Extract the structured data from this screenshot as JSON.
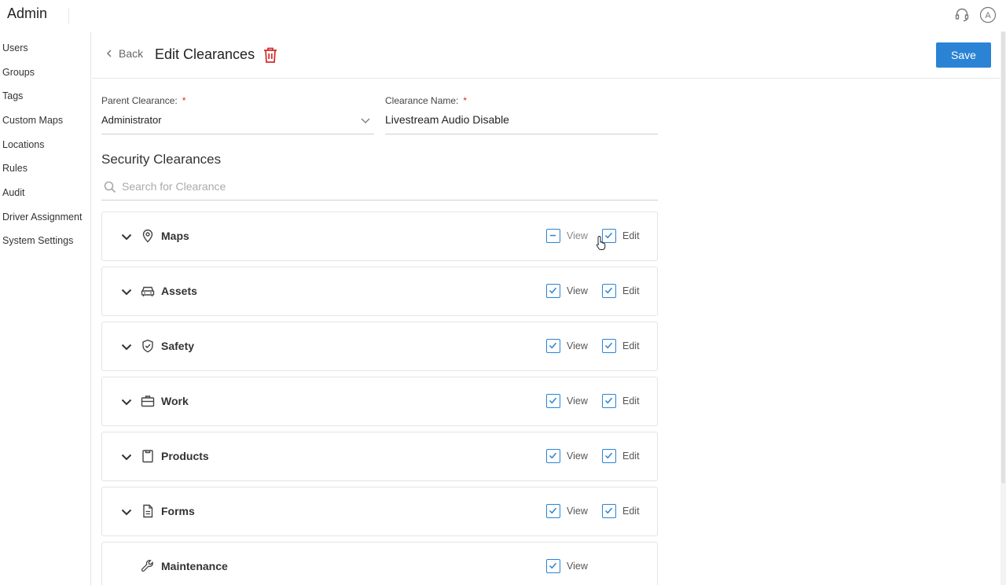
{
  "app": {
    "title": "Admin"
  },
  "top_icons": {
    "support": "headset-icon",
    "account": "account-icon",
    "account_letter": "A"
  },
  "sidebar": {
    "items": [
      {
        "label": "Users"
      },
      {
        "label": "Groups"
      },
      {
        "label": "Tags"
      },
      {
        "label": "Custom Maps"
      },
      {
        "label": "Locations"
      },
      {
        "label": "Rules"
      },
      {
        "label": "Audit"
      },
      {
        "label": "Driver Assignment"
      },
      {
        "label": "System Settings"
      }
    ]
  },
  "header": {
    "back_label": "Back",
    "title": "Edit Clearances",
    "save_label": "Save",
    "delete_icon": "trash-icon"
  },
  "form": {
    "parent": {
      "label": "Parent Clearance:",
      "required": "*",
      "value": "Administrator"
    },
    "name": {
      "label": "Clearance Name:",
      "required": "*",
      "value": "Livestream Audio Disable"
    }
  },
  "security": {
    "title": "Security Clearances",
    "search_placeholder": "Search for Clearance",
    "view_label": "View",
    "edit_label": "Edit",
    "items": [
      {
        "name": "Maps",
        "icon": "map-pin-icon",
        "expandable": true,
        "view": "partial",
        "edit": "checked"
      },
      {
        "name": "Assets",
        "icon": "car-icon",
        "expandable": true,
        "view": "checked",
        "edit": "checked"
      },
      {
        "name": "Safety",
        "icon": "shield-check-icon",
        "expandable": true,
        "view": "checked",
        "edit": "checked"
      },
      {
        "name": "Work",
        "icon": "briefcase-icon",
        "expandable": true,
        "view": "checked",
        "edit": "checked"
      },
      {
        "name": "Products",
        "icon": "clipboard-icon",
        "expandable": true,
        "view": "checked",
        "edit": "checked"
      },
      {
        "name": "Forms",
        "icon": "document-icon",
        "expandable": true,
        "view": "checked",
        "edit": "checked"
      },
      {
        "name": "Maintenance",
        "icon": "wrench-icon",
        "expandable": false,
        "view": "checked",
        "edit": "none"
      }
    ]
  },
  "colors": {
    "accent": "#2a83d4",
    "required": "#d32f2f",
    "delete": "#d32f2f"
  }
}
